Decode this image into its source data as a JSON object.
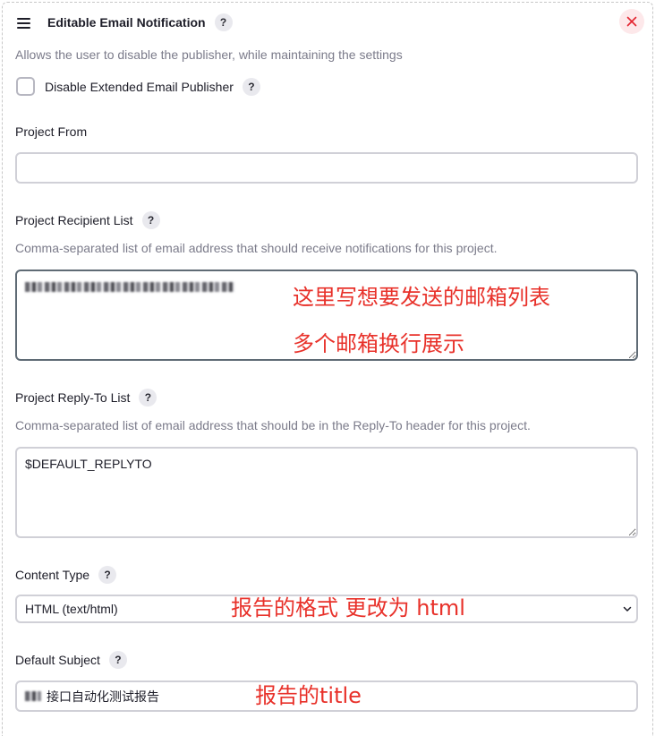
{
  "colors": {
    "text": "#1d1d28",
    "muted": "#7b7b8a",
    "input_border": "#d0d0d7",
    "focus_border": "#5f6b75",
    "help_bg": "#e9e9ee",
    "close_bg": "#fde8ea",
    "close_fg": "#e3242f",
    "annotation": "#e8312a",
    "dashed_border": "#c8c8c8"
  },
  "help_label": "?",
  "section": {
    "title": "Editable Email Notification",
    "description": "Allows the user to disable the publisher, while maintaining the settings",
    "menu_icon": "hamburger-icon",
    "close_icon": "close-icon"
  },
  "disable_publisher": {
    "label": "Disable Extended Email Publisher",
    "checked": false
  },
  "project_from": {
    "label": "Project From",
    "value": ""
  },
  "recipient_list": {
    "label": "Project Recipient List",
    "description": "Comma-separated list of email address that should receive notifications for this project."
  },
  "reply_to": {
    "label": "Project Reply-To List",
    "description": "Comma-separated list of email address that should be in the Reply-To header for this project.",
    "value": "$DEFAULT_REPLYTO"
  },
  "content_type": {
    "label": "Content Type",
    "selected": "HTML (text/html)",
    "dropdown_icon": "chevron-down-icon"
  },
  "default_subject": {
    "label": "Default Subject",
    "value": "接口自动化测试报告"
  },
  "annotations": {
    "recipient_line1": "这里写想要发送的邮箱列表",
    "recipient_line2": "多个邮箱换行展示",
    "content_type": "报告的格式 更改为 html",
    "subject": "报告的title"
  }
}
